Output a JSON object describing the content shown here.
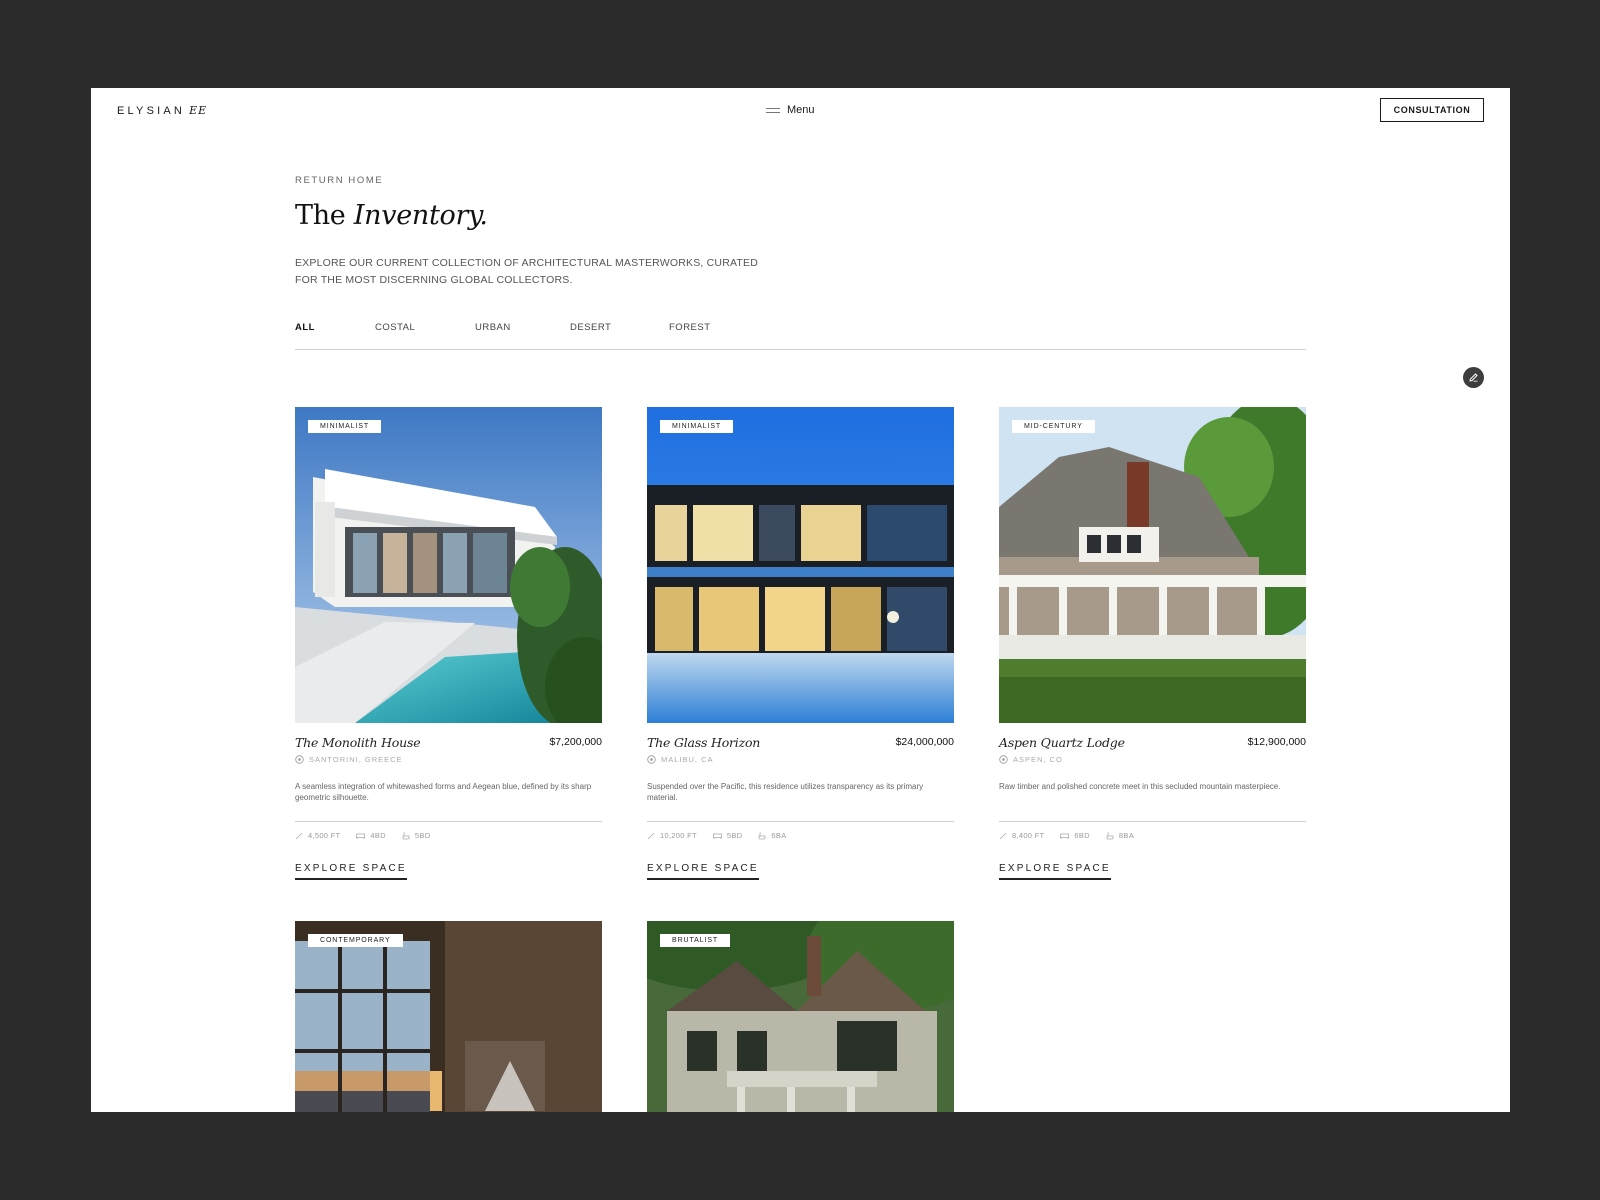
{
  "header": {
    "logo_text": "ELYSIAN",
    "logo_mark": "EE",
    "menu_label": "Menu",
    "cta_label": "CONSULTATION"
  },
  "intro": {
    "return_label": "RETURN HOME",
    "title_plain": "The",
    "title_italic": "Inventory.",
    "subtitle": "EXPLORE OUR CURRENT COLLECTION OF ARCHITECTURAL MASTERWORKS, CURATED FOR THE MOST DISCERNING GLOBAL COLLECTORS."
  },
  "tabs": [
    {
      "label": "ALL",
      "active": true
    },
    {
      "label": "COSTAL",
      "active": false
    },
    {
      "label": "URBAN",
      "active": false
    },
    {
      "label": "DESERT",
      "active": false
    },
    {
      "label": "FOREST",
      "active": false
    }
  ],
  "fab_icon": "pencil-icon",
  "listings": [
    {
      "badge": "MINIMALIST",
      "name": "The Monolith House",
      "price": "$7,200,000",
      "location": "SANTORINI, GREECE",
      "description": "A seamless integration of whitewashed forms and Aegean blue, defined by its sharp geometric silhouette.",
      "area": "4,500 FT",
      "beds": "4BD",
      "baths": "5BD",
      "cta": "EXPLORE SPACE",
      "photo_icon": "white-villa-pool-photo"
    },
    {
      "badge": "MINIMALIST",
      "name": "The Glass Horizon",
      "price": "$24,000,000",
      "location": "MALIBU, CA",
      "description": "Suspended over the Pacific, this residence utilizes transparency as its primary material.",
      "area": "10,200 FT",
      "beds": "5BD",
      "baths": "6BA",
      "cta": "EXPLORE SPACE",
      "photo_icon": "glass-house-dusk-photo"
    },
    {
      "badge": "MID-CENTURY",
      "name": "Aspen Quartz Lodge",
      "price": "$12,900,000",
      "location": "ASPEN, CO",
      "description": "Raw timber and polished concrete meet in this secluded mountain masterpiece.",
      "area": "8,400 FT",
      "beds": "6BD",
      "baths": "8BA",
      "cta": "EXPLORE SPACE",
      "photo_icon": "shingle-house-porch-photo"
    },
    {
      "badge": "CONTEMPORARY",
      "photo_icon": "interior-window-photo"
    },
    {
      "badge": "BRUTALIST",
      "photo_icon": "tudor-manor-photo"
    }
  ],
  "icons": {
    "location": "location-pin-icon",
    "area": "area-arrow-icon",
    "beds": "bed-icon",
    "baths": "bath-icon"
  },
  "colors": {
    "background": "#2b2b2b",
    "page": "#ffffff",
    "text": "#1a1a1a",
    "muted": "#9a9a9a"
  }
}
